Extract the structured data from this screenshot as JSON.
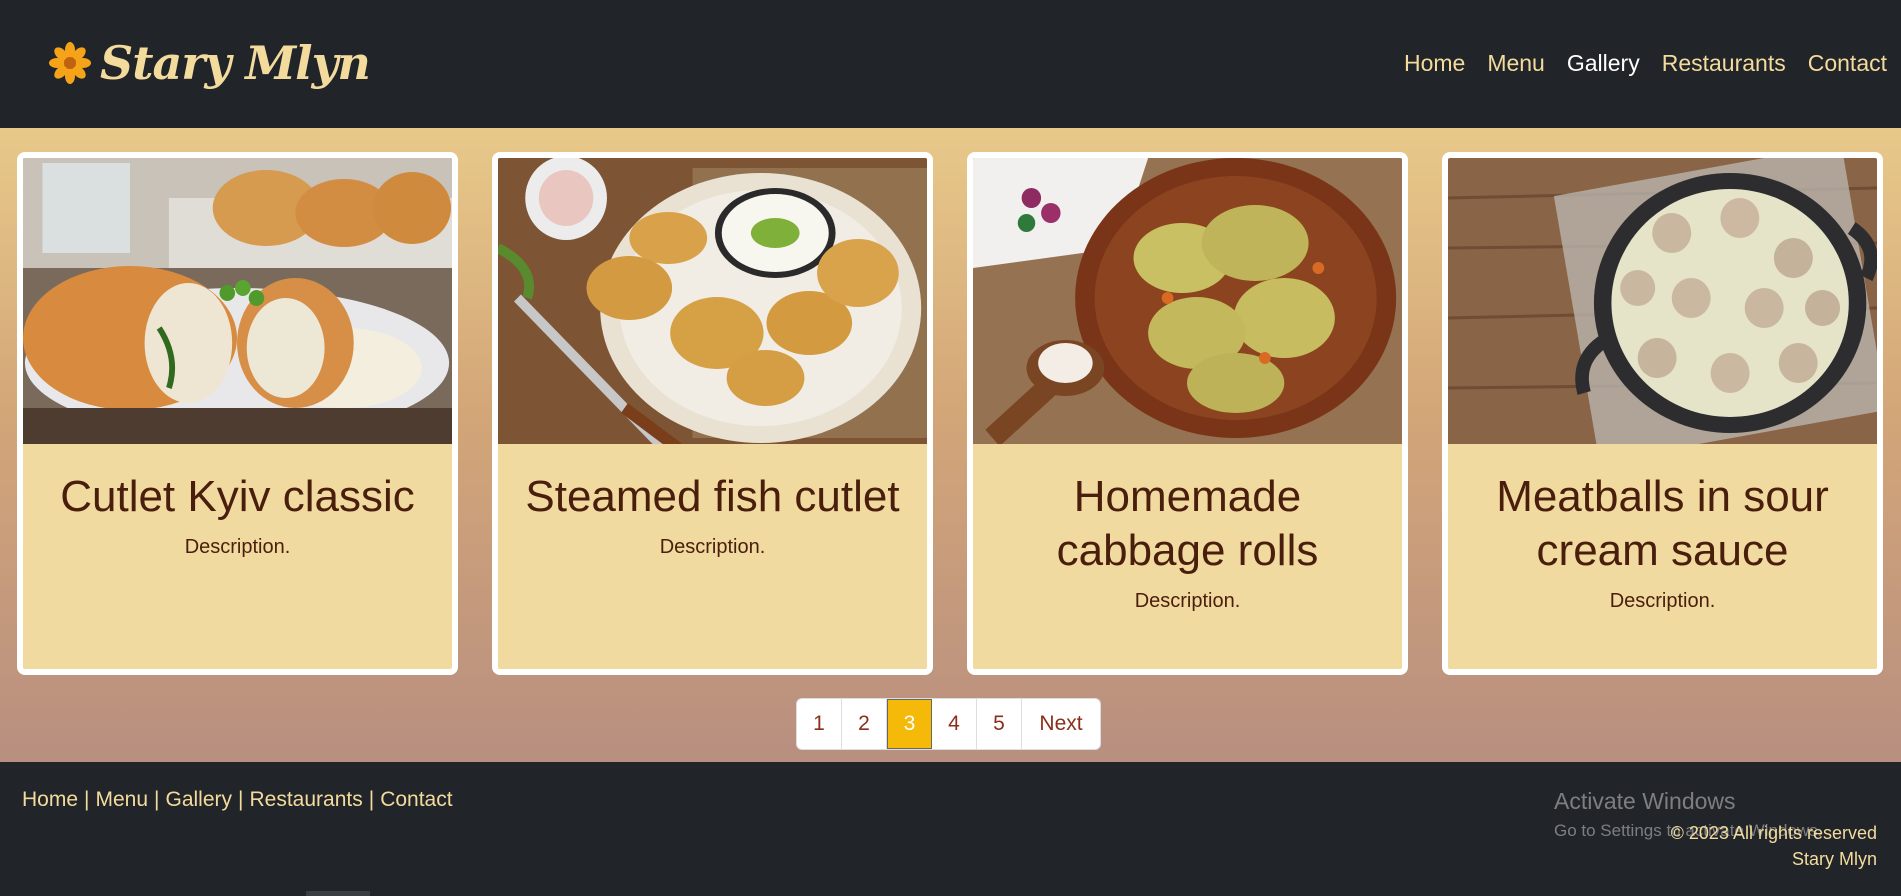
{
  "header": {
    "brand": "Stary Mlyn",
    "nav": [
      {
        "label": "Home",
        "active": false
      },
      {
        "label": "Menu",
        "active": false
      },
      {
        "label": "Gallery",
        "active": true
      },
      {
        "label": "Restaurants",
        "active": false
      },
      {
        "label": "Contact",
        "active": false
      }
    ]
  },
  "cards": [
    {
      "title": "Cutlet Kyiv classic",
      "description": "Description.",
      "image": "chicken-kyiv-photo"
    },
    {
      "title": "Steamed fish cutlet",
      "description": "Description.",
      "image": "fish-cutlets-photo"
    },
    {
      "title": "Homemade cabbage rolls",
      "description": "Description.",
      "image": "cabbage-rolls-photo"
    },
    {
      "title": "Meatballs in sour cream sauce",
      "description": "Description.",
      "image": "meatballs-pan-photo"
    }
  ],
  "pagination": {
    "pages": [
      "1",
      "2",
      "3",
      "4",
      "5"
    ],
    "current": "3",
    "next_label": "Next"
  },
  "footer": {
    "links": [
      "Home",
      "Menu",
      "Gallery",
      "Restaurants",
      "Contact"
    ],
    "copyright_line1": "© 2023 All rights reserved",
    "copyright_line2": "Stary Mlyn"
  },
  "os_watermark": {
    "line1": "Activate Windows",
    "line2": "Go to Settings to activate Windows."
  },
  "colors": {
    "header_bg": "#212428",
    "brand_text": "#f3db9e",
    "card_bg": "#f1da9f",
    "title_text": "#4a1e0c",
    "pagination_active": "#f5b90a"
  }
}
